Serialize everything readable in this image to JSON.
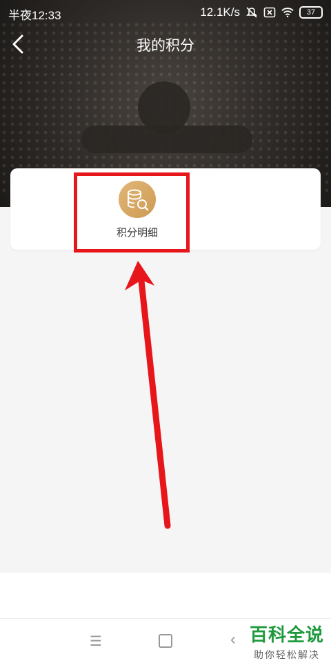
{
  "status_bar": {
    "time": "半夜12:33",
    "net_speed": "12.1K/s",
    "battery": "37"
  },
  "header": {
    "title": "我的积分"
  },
  "card": {
    "items": [
      {
        "label": "积分明细",
        "icon": "coins-search-icon"
      }
    ]
  },
  "system_bar": {
    "menu_glyph": "☰",
    "back_glyph": "‹"
  },
  "watermark": {
    "brand": "百科全说",
    "slogan": "助你轻松解决"
  },
  "colors": {
    "annotation": "#e6161b",
    "coin": "#d4a460",
    "watermark_green": "#1e9a3c"
  }
}
